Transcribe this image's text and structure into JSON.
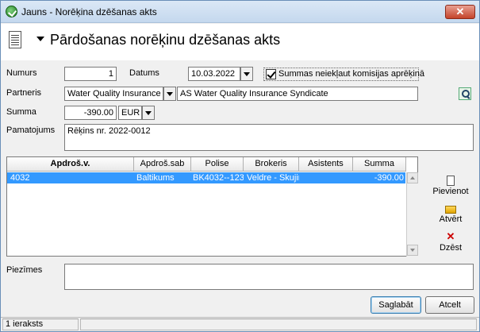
{
  "window": {
    "title": "Jauns - Norēķina dzēšanas akts",
    "close_label": "✕"
  },
  "header": {
    "title": "Pārdošanas norēķinu dzēšanas akts"
  },
  "form": {
    "numurs_label": "Numurs",
    "numurs_value": "1",
    "datums_label": "Datums",
    "datums_value": "10.03.2022",
    "summas_checkbox_label": "Summas neiekļaut komisijas aprēķinā",
    "summas_checkbox_checked": true,
    "partneris_label": "Partneris",
    "partneris_code": "Water Quality Insurance S",
    "partneris_name": "AS Water Quality Insurance Syndicate",
    "summa_label": "Summa",
    "summa_value": "-390.00",
    "currency_value": "EUR",
    "pamatojums_label": "Pamatojums",
    "pamatojums_value": "Rēķins nr. 2022-0012",
    "piezimes_label": "Piezīmes",
    "piezimes_value": ""
  },
  "grid": {
    "columns": [
      "Apdroš.v.",
      "Apdroš.sab",
      "Polise",
      "Brokeris",
      "Asistents",
      "Summa"
    ],
    "rows": [
      {
        "apdros_v": "4032",
        "apdros_sab": "Baltikums",
        "polise": "BK4032--123",
        "brokeris": "Veldre - Skujiņ",
        "asistents": "",
        "summa": "-390.00"
      }
    ]
  },
  "side_buttons": {
    "pievienot": "Pievienot",
    "atvert": "Atvērt",
    "dzest": "Dzēst"
  },
  "buttons": {
    "save": "Saglabāt",
    "cancel": "Atcelt"
  },
  "status": {
    "records": "1 ieraksts"
  },
  "colors": {
    "selection": "#3399ff",
    "titlebar": "#c4d8ee"
  }
}
